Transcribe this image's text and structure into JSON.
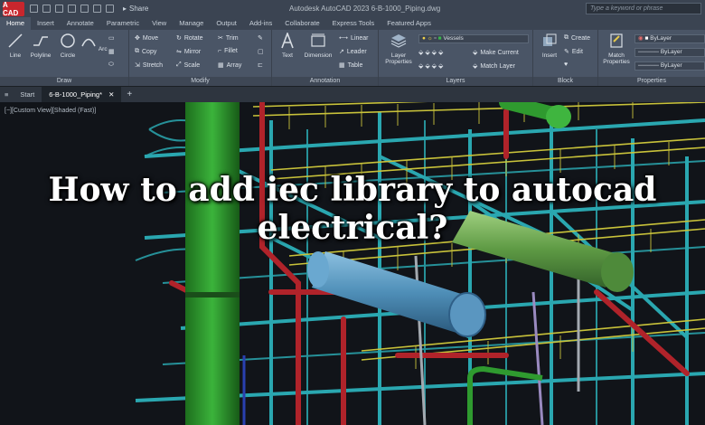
{
  "titlebar": {
    "app_logo": "A CAD",
    "share_label": "Share",
    "window_title": "Autodesk AutoCAD 2023     6-B-1000_Piping.dwg",
    "search_placeholder": "Type a keyword or phrase"
  },
  "ribbon_tabs": [
    "Home",
    "Insert",
    "Annotate",
    "Parametric",
    "View",
    "Manage",
    "Output",
    "Add-ins",
    "Collaborate",
    "Express Tools",
    "Featured Apps"
  ],
  "ribbon": {
    "draw": {
      "title": "Draw",
      "tools": [
        "Line",
        "Polyline",
        "Circle",
        "Arc"
      ]
    },
    "modify": {
      "title": "Modify",
      "tools": [
        "Move",
        "Rotate",
        "Trim",
        "Copy",
        "Mirror",
        "Fillet",
        "Stretch",
        "Scale",
        "Array"
      ]
    },
    "annotation": {
      "title": "Annotation",
      "tools": [
        "Text",
        "Dimension",
        "Linear",
        "Leader",
        "Table"
      ]
    },
    "layers": {
      "title": "Layers",
      "layer_properties": "Layer Properties",
      "current_layer": "Vessels",
      "make_current": "Make Current",
      "match_layer": "Match Layer"
    },
    "block": {
      "title": "Block",
      "insert": "Insert",
      "create": "Create",
      "edit": "Edit"
    },
    "properties": {
      "title": "Properties",
      "match_properties": "Match Properties",
      "color": "ByLayer",
      "linetype": "ByLayer",
      "lineweight": "ByLayer"
    }
  },
  "file_tabs": {
    "start": "Start",
    "active": "6-B-1000_Piping*"
  },
  "viewport": {
    "label": "[−][Custom View][Shaded (Fast)]"
  },
  "headline": {
    "line1": "How to add iec library to autocad",
    "line2": "electrical?"
  },
  "colors": {
    "accent": "#c8262d",
    "steel": "#2aa7b0",
    "rails": "#c8c23a",
    "pipe_green": "#2f9a2f",
    "pipe_red": "#b0232a",
    "vessel": "#5fa0c8"
  }
}
